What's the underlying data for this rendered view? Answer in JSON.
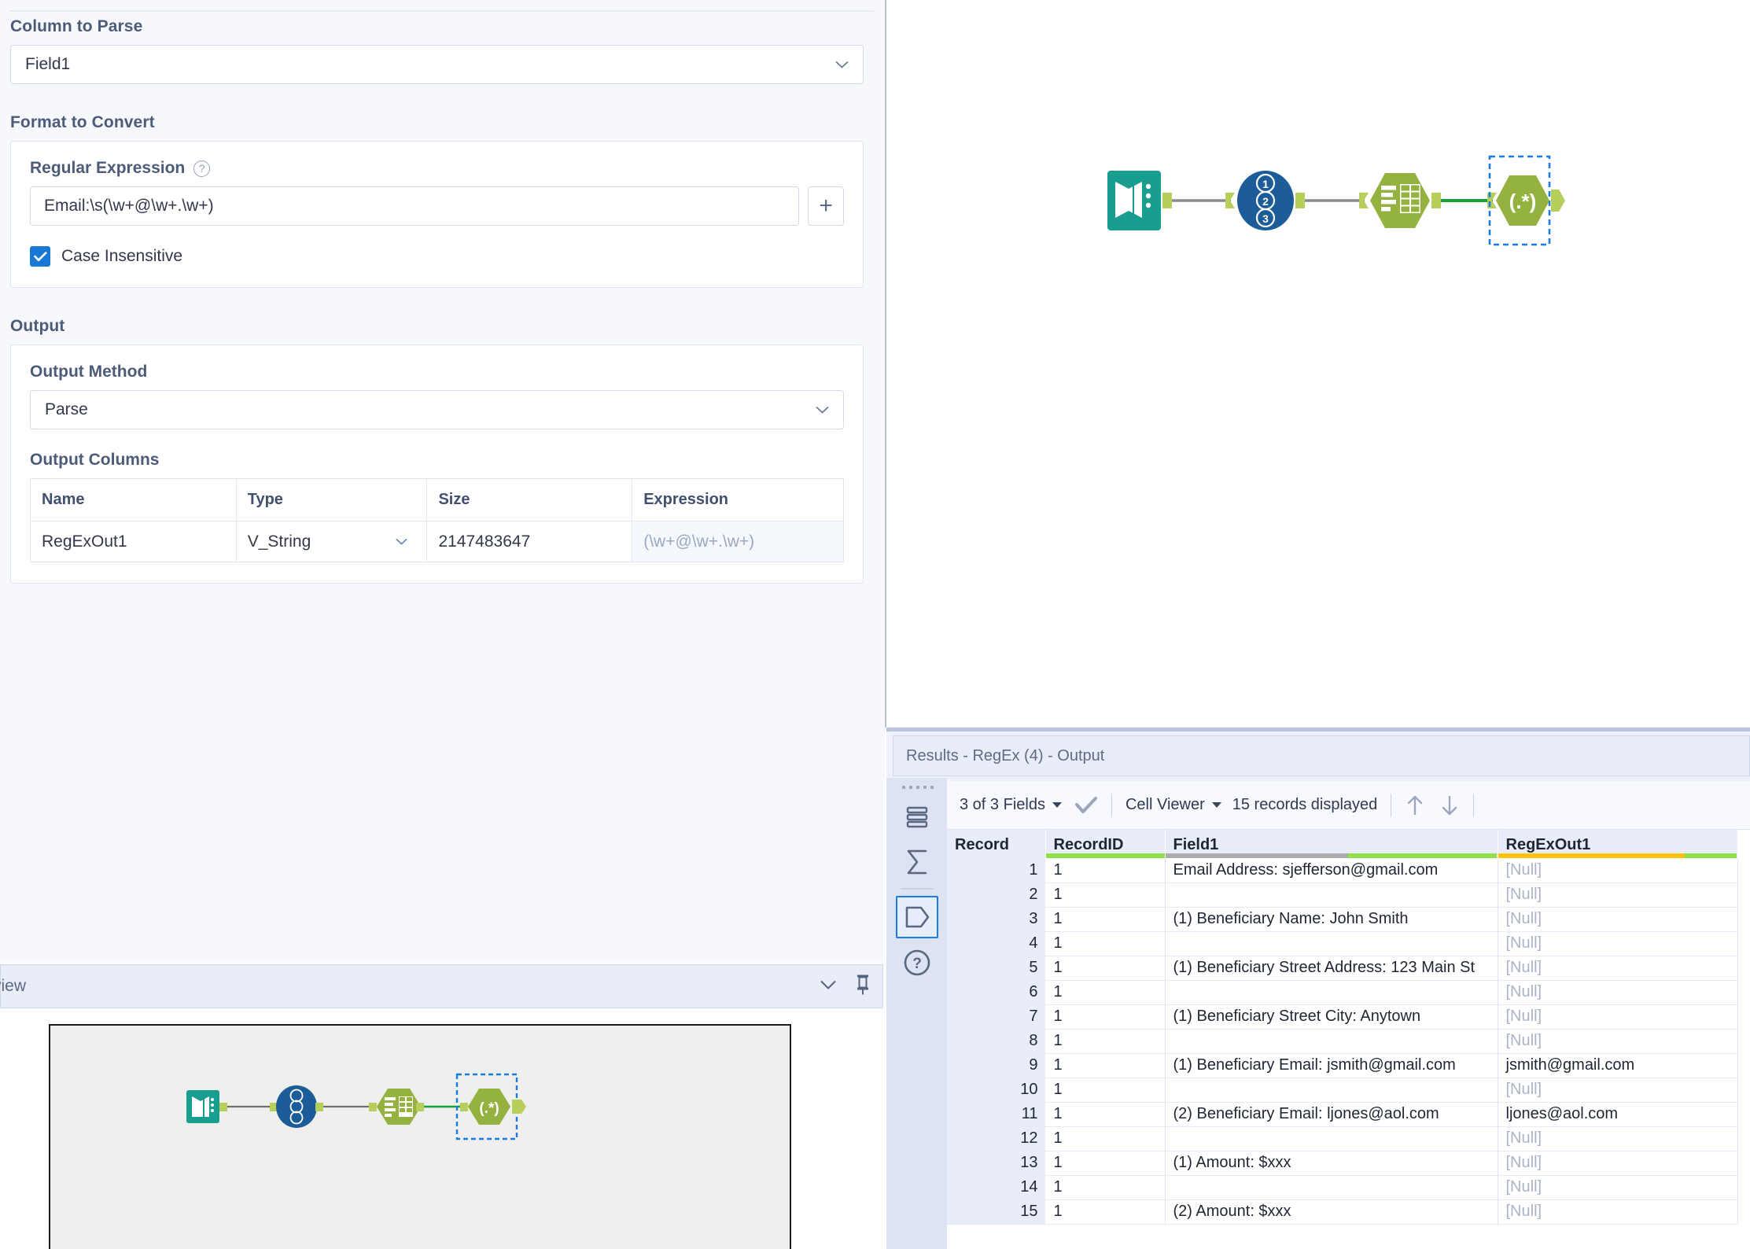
{
  "config": {
    "column_to_parse": {
      "label": "Column to Parse",
      "value": "Field1"
    },
    "format_to_convert": {
      "label": "Format to Convert",
      "regex_label": "Regular Expression",
      "help_icon": "help-circle-icon",
      "regex_value": "Email:\\s(\\w+@\\w+.\\w+)",
      "add_icon": "plus-icon",
      "case_insensitive_label": "Case Insensitive",
      "case_insensitive_checked": true
    },
    "output": {
      "label": "Output",
      "method_label": "Output Method",
      "method_value": "Parse",
      "columns_label": "Output Columns",
      "table_headers": [
        "Name",
        "Type",
        "Size",
        "Expression"
      ],
      "rows": [
        {
          "name": "RegExOut1",
          "type": "V_String",
          "size": "2147483647",
          "expression": "(\\w+@\\w+.\\w+)"
        }
      ]
    }
  },
  "overview": {
    "title": "view",
    "collapse_icon": "chevron-down-icon",
    "pin_icon": "pin-icon"
  },
  "workflow": {
    "tools": [
      {
        "name": "input-data-tool",
        "icon": "book-icon"
      },
      {
        "name": "record-id-tool",
        "icon": "numbered-list-icon"
      },
      {
        "name": "text-to-columns-tool",
        "icon": "table-rows-icon"
      },
      {
        "name": "regex-tool",
        "icon": "regex-icon",
        "label": "(.*)",
        "selected": true
      }
    ]
  },
  "results": {
    "title": "Results - RegEx (4) - Output",
    "toolbar": {
      "fields_label": "3 of 3 Fields",
      "fields_caret": "caret-down-icon",
      "check_icon": "checkmark-icon",
      "viewer_label": "Cell Viewer",
      "viewer_caret": "caret-down-icon",
      "records_label": "15 records displayed",
      "up_icon": "arrow-up-icon",
      "down_icon": "arrow-down-icon"
    },
    "rail": [
      {
        "name": "data-grid-icon",
        "selected": false
      },
      {
        "name": "sigma-sum-icon",
        "selected": false
      },
      {
        "name": "metadata-tag-icon",
        "selected": true
      },
      {
        "name": "help-circle-icon",
        "selected": false
      }
    ],
    "grid": {
      "headers": [
        "Record",
        "RecordID",
        "Field1",
        "RegExOut1"
      ],
      "null_text": "[Null]",
      "rows": [
        {
          "record": "1",
          "record_id": "1",
          "field1": "Email Address: sjefferson@gmail.com",
          "regexout1": "[Null]",
          "is_null": true
        },
        {
          "record": "2",
          "record_id": "1",
          "field1": "",
          "regexout1": "[Null]",
          "is_null": true
        },
        {
          "record": "3",
          "record_id": "1",
          "field1": "(1) Beneficiary Name: John Smith",
          "regexout1": "[Null]",
          "is_null": true
        },
        {
          "record": "4",
          "record_id": "1",
          "field1": "",
          "regexout1": "[Null]",
          "is_null": true
        },
        {
          "record": "5",
          "record_id": "1",
          "field1": "(1) Beneficiary Street Address: 123 Main St",
          "regexout1": "[Null]",
          "is_null": true
        },
        {
          "record": "6",
          "record_id": "1",
          "field1": "",
          "regexout1": "[Null]",
          "is_null": true
        },
        {
          "record": "7",
          "record_id": "1",
          "field1": "(1) Beneficiary Street City: Anytown",
          "regexout1": "[Null]",
          "is_null": true
        },
        {
          "record": "8",
          "record_id": "1",
          "field1": "",
          "regexout1": "[Null]",
          "is_null": true
        },
        {
          "record": "9",
          "record_id": "1",
          "field1": "(1) Beneficiary Email: jsmith@gmail.com",
          "regexout1": "jsmith@gmail.com",
          "is_null": false
        },
        {
          "record": "10",
          "record_id": "1",
          "field1": "",
          "regexout1": "[Null]",
          "is_null": true
        },
        {
          "record": "11",
          "record_id": "1",
          "field1": "(2) Beneficiary Email: ljones@aol.com",
          "regexout1": "ljones@aol.com",
          "is_null": false
        },
        {
          "record": "12",
          "record_id": "1",
          "field1": "",
          "regexout1": "[Null]",
          "is_null": true
        },
        {
          "record": "13",
          "record_id": "1",
          "field1": "(1) Amount: $xxx",
          "regexout1": "[Null]",
          "is_null": true
        },
        {
          "record": "14",
          "record_id": "1",
          "field1": "",
          "regexout1": "[Null]",
          "is_null": true
        },
        {
          "record": "15",
          "record_id": "1",
          "field1": "(2) Amount: $xxx",
          "regexout1": "[Null]",
          "is_null": true
        }
      ]
    }
  },
  "colors": {
    "accent_blue": "#1878d4",
    "panel_bg": "#f6f8fc",
    "header_bg": "#e8edf9",
    "quality_green": "#8fe04a",
    "quality_gray": "#adadad",
    "quality_yellow": "#ffc400",
    "tool_teal": "#179e8e",
    "tool_navy": "#1b5c99",
    "tool_olive": "#93b23f",
    "null_text": "#a9b4c8"
  }
}
